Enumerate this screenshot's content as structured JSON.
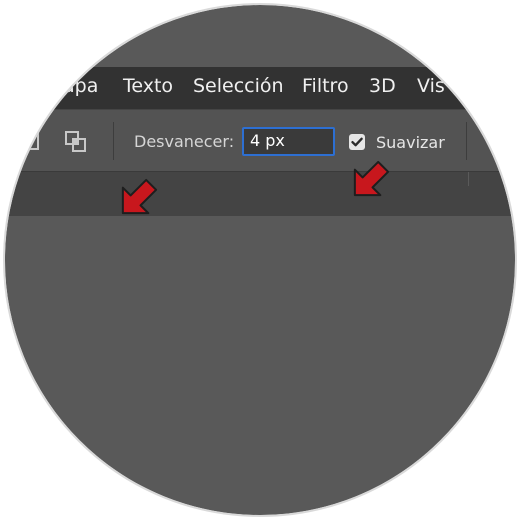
{
  "menubar": {
    "items": [
      {
        "label": "apa"
      },
      {
        "label": "Texto"
      },
      {
        "label": "Selección"
      },
      {
        "label": "Filtro"
      },
      {
        "label": "3D"
      },
      {
        "label": "Vis"
      }
    ]
  },
  "options": {
    "feather_label": "Desvanecer:",
    "feather_value": "4 px",
    "antialias_label": "Suavizar",
    "antialias_checked": true
  },
  "colors": {
    "menubar_bg": "#323232",
    "optionsbar_bg": "#535353",
    "tabbar_bg": "#444444",
    "canvas_bg": "#595959",
    "input_focus_border": "#2d6fd2",
    "arrow_fill": "#c8171d"
  },
  "icons": {
    "left_icon": "selection-mode-icon",
    "intersect_icon": "intersect-selection-icon",
    "arrow_icon": "red-pointer-arrow"
  }
}
